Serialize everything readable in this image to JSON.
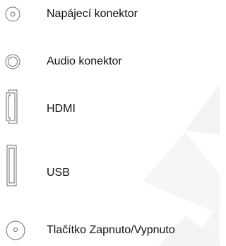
{
  "items": [
    {
      "label": "Napájecí konektor",
      "icon": "power-connector-icon"
    },
    {
      "label": "Audio konektor",
      "icon": "audio-connector-icon"
    },
    {
      "label": "HDMI",
      "icon": "hdmi-port-icon"
    },
    {
      "label": "USB",
      "icon": "usb-port-icon"
    },
    {
      "label": "Tlačítko Zapnuto/Vypnuto",
      "icon": "power-button-icon"
    }
  ],
  "colors": {
    "text": "#111111",
    "icon_stroke": "#6e6e6e",
    "watermark": "#f1f1f1"
  }
}
